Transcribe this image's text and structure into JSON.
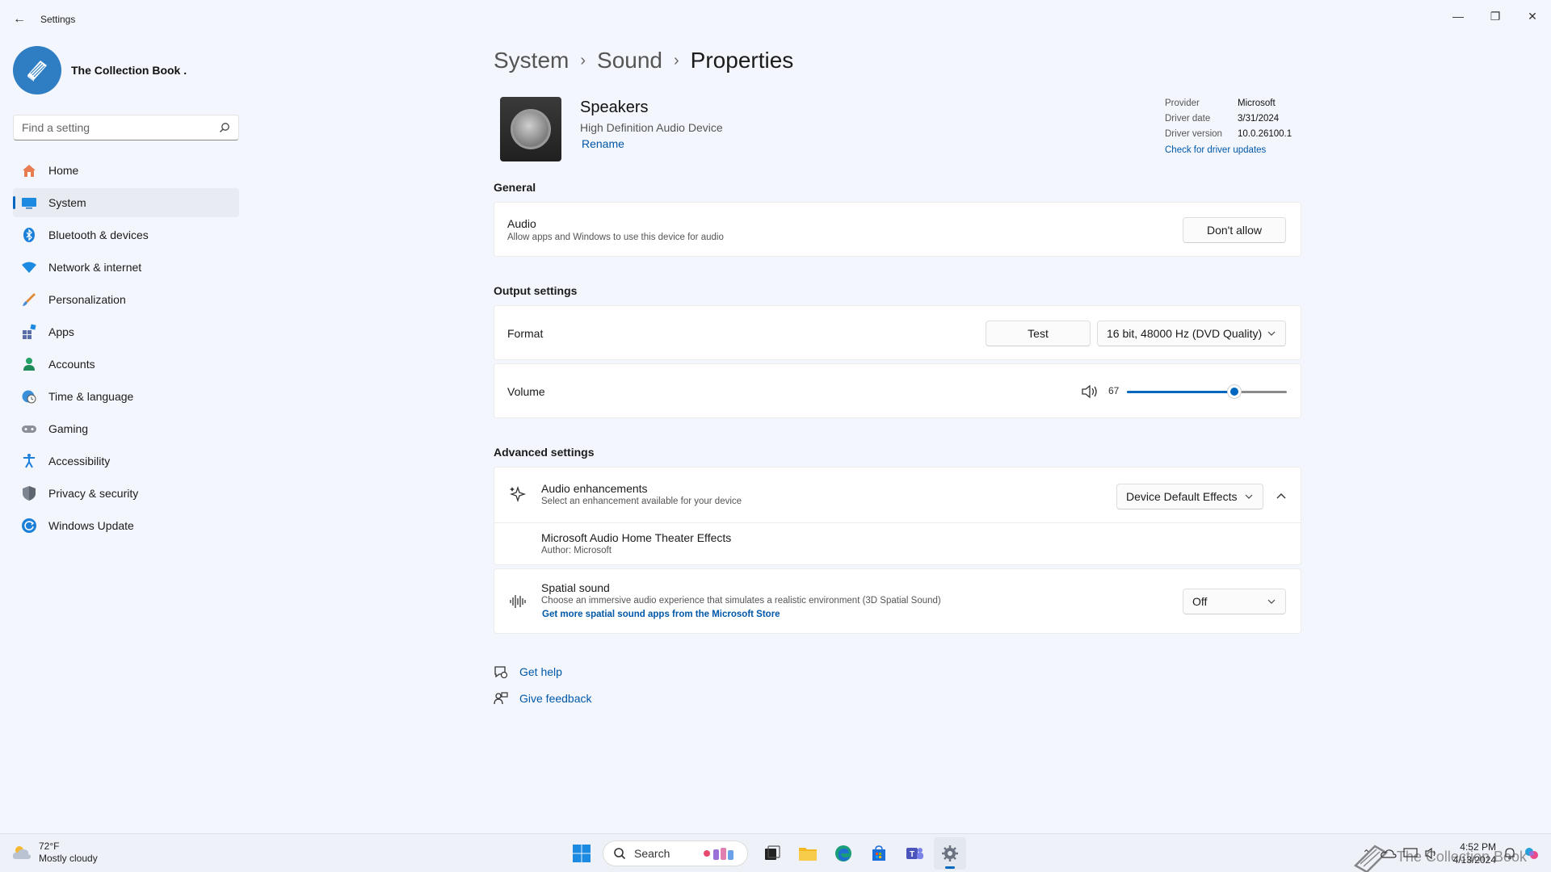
{
  "window": {
    "title": "Settings"
  },
  "profile": {
    "name": "The Collection Book ."
  },
  "search": {
    "placeholder": "Find a setting"
  },
  "nav": {
    "items": [
      {
        "label": "Home",
        "icon": "home-icon"
      },
      {
        "label": "System",
        "icon": "monitor-icon",
        "active": true
      },
      {
        "label": "Bluetooth & devices",
        "icon": "bluetooth-icon"
      },
      {
        "label": "Network & internet",
        "icon": "wifi-icon"
      },
      {
        "label": "Personalization",
        "icon": "brush-icon"
      },
      {
        "label": "Apps",
        "icon": "apps-icon"
      },
      {
        "label": "Accounts",
        "icon": "person-icon"
      },
      {
        "label": "Time & language",
        "icon": "globe-clock-icon"
      },
      {
        "label": "Gaming",
        "icon": "gamepad-icon"
      },
      {
        "label": "Accessibility",
        "icon": "accessibility-icon"
      },
      {
        "label": "Privacy & security",
        "icon": "shield-icon"
      },
      {
        "label": "Windows Update",
        "icon": "update-icon"
      }
    ]
  },
  "breadcrumb": {
    "items": [
      "System",
      "Sound"
    ],
    "current": "Properties"
  },
  "device": {
    "name": "Speakers",
    "subtitle": "High Definition Audio Device",
    "rename": "Rename",
    "driver": {
      "rows": [
        {
          "key": "Provider",
          "value": "Microsoft"
        },
        {
          "key": "Driver date",
          "value": "3/31/2024"
        },
        {
          "key": "Driver version",
          "value": "10.0.26100.1"
        }
      ],
      "update_link": "Check for driver updates"
    }
  },
  "general": {
    "title": "General",
    "audio": {
      "label": "Audio",
      "description": "Allow apps and Windows to use this device for audio",
      "button": "Don't allow"
    }
  },
  "output": {
    "title": "Output settings",
    "format": {
      "label": "Format",
      "test_button": "Test",
      "selected": "16 bit, 48000 Hz (DVD Quality)"
    },
    "volume": {
      "label": "Volume",
      "value": "67",
      "level": 0.67
    }
  },
  "advanced": {
    "title": "Advanced settings",
    "enhancements": {
      "label": "Audio enhancements",
      "description": "Select an enhancement available for your device",
      "selected": "Device Default Effects"
    },
    "effect": {
      "name": "Microsoft Audio Home Theater Effects",
      "author": "Author: Microsoft"
    },
    "spatial": {
      "label": "Spatial sound",
      "description": "Choose an immersive audio experience that simulates a realistic environment (3D Spatial Sound)",
      "link": "Get more spatial sound apps from the Microsoft Store",
      "selected": "Off"
    }
  },
  "help": {
    "get_help": "Get help",
    "feedback": "Give feedback"
  },
  "taskbar": {
    "weather": {
      "temp": "72°F",
      "condition": "Mostly cloudy"
    },
    "search_label": "Search",
    "time": "4:52 PM",
    "date": "4/13/2024"
  },
  "watermark": "The Collection Book",
  "colors": {
    "accent": "#0067c0",
    "link": "#0058a8",
    "background": "#f3f6fc"
  }
}
